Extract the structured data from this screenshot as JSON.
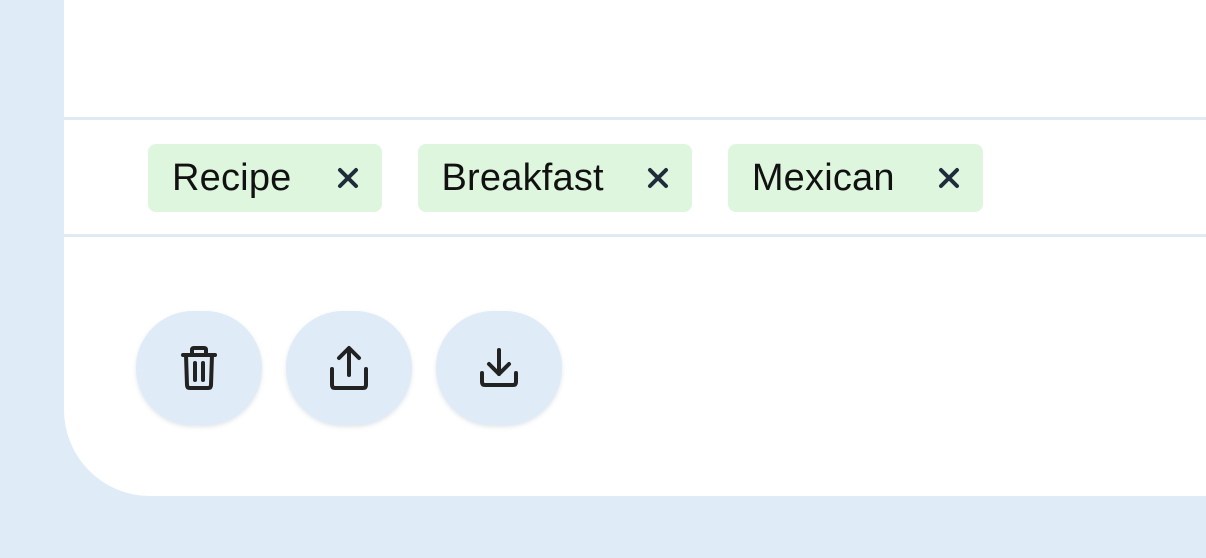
{
  "tags": [
    {
      "label": "Recipe",
      "remove_icon": "close-icon"
    },
    {
      "label": "Breakfast",
      "remove_icon": "close-icon"
    },
    {
      "label": "Mexican",
      "remove_icon": "close-icon"
    }
  ],
  "actions": [
    {
      "name": "delete",
      "icon": "trash-icon"
    },
    {
      "name": "share",
      "icon": "share-icon"
    },
    {
      "name": "download",
      "icon": "download-icon"
    }
  ],
  "colors": {
    "page_background": "#dfebf7",
    "card_background": "#ffffff",
    "tag_background": "#def5de",
    "icon_color": "#1f2d3a",
    "action_button_background": "#dfebf7"
  }
}
